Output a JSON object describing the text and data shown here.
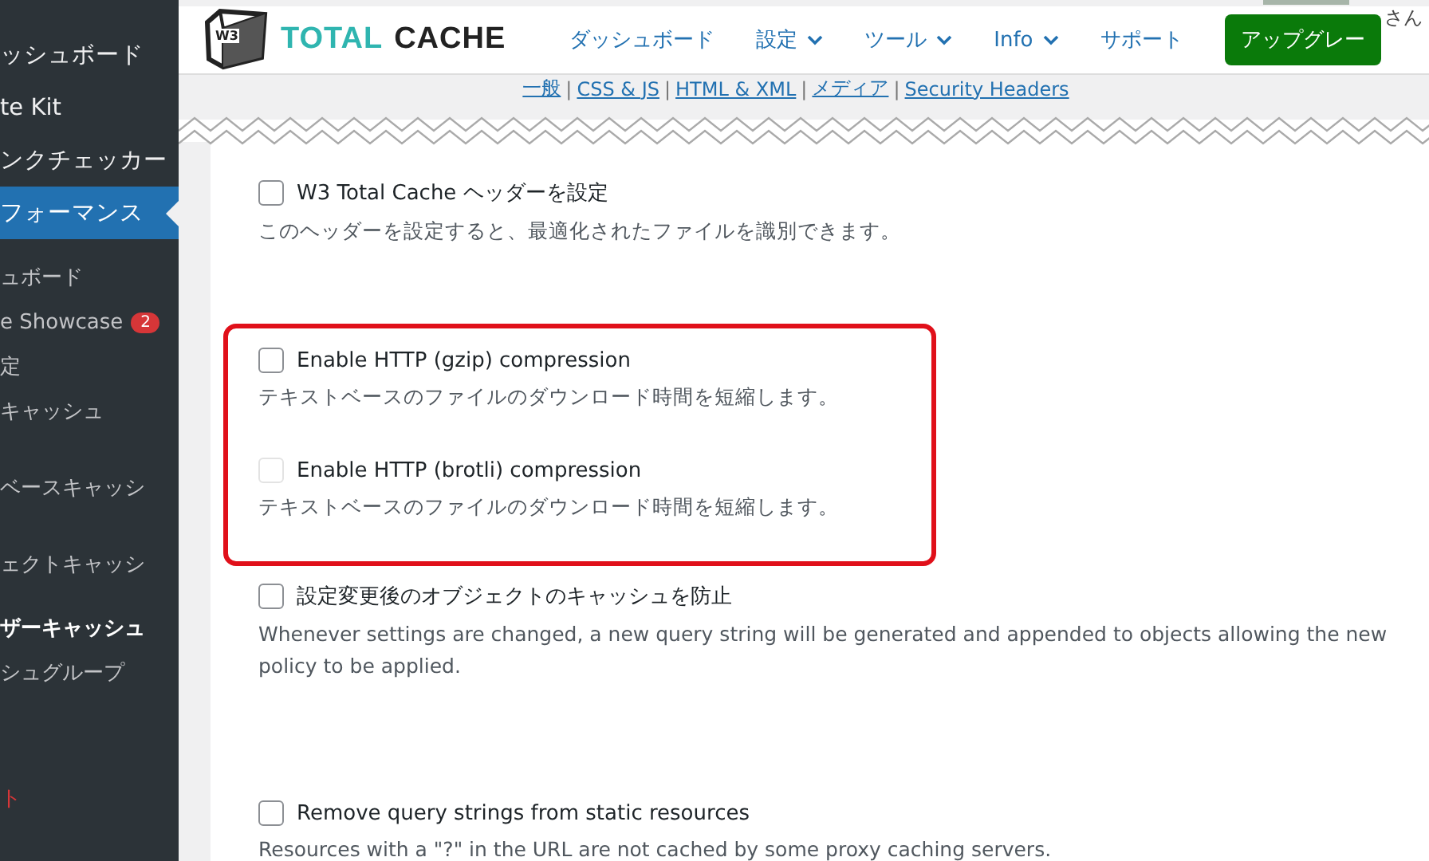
{
  "sidebar": {
    "items": [
      {
        "label": "ッシュボード",
        "kind": "top",
        "selected": false
      },
      {
        "label": "te Kit",
        "kind": "top",
        "selected": false
      },
      {
        "label": "ンクチェッカー",
        "kind": "top",
        "selected": false
      },
      {
        "label": "フォーマンス",
        "kind": "top",
        "selected": true
      },
      {
        "label": "ュボード",
        "kind": "sub",
        "selected": false
      },
      {
        "label": "e Showcase",
        "kind": "sub",
        "selected": false,
        "badge": "2"
      },
      {
        "label": "定",
        "kind": "sub",
        "selected": false
      },
      {
        "label": "キャッシュ",
        "kind": "sub",
        "selected": false
      },
      {
        "label": "ベースキャッシ",
        "kind": "sub",
        "selected": false
      },
      {
        "label": "ェクトキャッシ",
        "kind": "sub",
        "selected": false
      },
      {
        "label": "ザーキャッシュ",
        "kind": "sub",
        "selected": true
      },
      {
        "label": "シュグループ",
        "kind": "sub",
        "selected": false
      },
      {
        "label": "ト",
        "kind": "alert",
        "selected": false
      }
    ]
  },
  "header": {
    "logo": {
      "badge": "W3",
      "word_1": "TOTAL",
      "word_2": "CACHE"
    },
    "nav": [
      {
        "label": "ダッシュボード",
        "dropdown": false
      },
      {
        "label": "設定",
        "dropdown": true
      },
      {
        "label": "ツール",
        "dropdown": true
      },
      {
        "label": "Info",
        "dropdown": true
      },
      {
        "label": "サポート",
        "dropdown": false
      }
    ],
    "upgrade_button": "アップグレー",
    "greeting": "さん"
  },
  "subnav": [
    {
      "kind": "link",
      "label": "一般"
    },
    {
      "kind": "separator",
      "label": "|"
    },
    {
      "kind": "link",
      "label": "CSS & JS"
    },
    {
      "kind": "separator",
      "label": "|"
    },
    {
      "kind": "link",
      "label": "HTML & XML"
    },
    {
      "kind": "separator",
      "label": "|"
    },
    {
      "kind": "link",
      "label": "メディア"
    },
    {
      "kind": "separator",
      "label": "|"
    },
    {
      "kind": "link",
      "label": "Security Headers"
    }
  ],
  "options": [
    {
      "label": "W3 Total Cache ヘッダーを設定",
      "description": "このヘッダーを設定すると、最適化されたファイルを識別できます。",
      "checked": false,
      "disabled": false,
      "highlighted": false
    },
    {
      "label": "Enable HTTP (gzip) compression",
      "description": "テキストベースのファイルのダウンロード時間を短縮します。",
      "checked": false,
      "disabled": false,
      "highlighted": true
    },
    {
      "label": "Enable HTTP (brotli) compression",
      "description": "テキストベースのファイルのダウンロード時間を短縮します。",
      "checked": false,
      "disabled": true,
      "highlighted": true
    },
    {
      "label": "設定変更後のオブジェクトのキャッシュを防止",
      "description": "Whenever settings are changed, a new query string will be generated and appended to objects allowing the new policy to be applied.",
      "checked": false,
      "disabled": false,
      "highlighted": false
    },
    {
      "label": "Remove query strings from static resources",
      "description": "Resources with a \"?\" in the URL are not cached by some proxy caching servers.",
      "checked": false,
      "disabled": false,
      "highlighted": false
    }
  ]
}
